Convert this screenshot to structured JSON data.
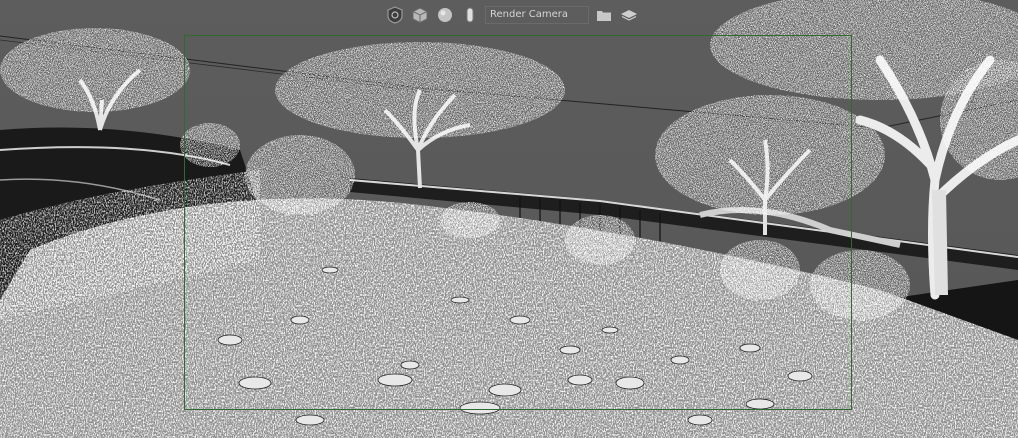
{
  "viewport": {
    "toolbar": {
      "camera_name": "Render Camera",
      "icons": [
        "camera-shield-icon",
        "cube-icon",
        "sphere-icon",
        "light-icon",
        "folder-icon",
        "layers-icon"
      ]
    }
  },
  "colors": {
    "background": "#5b5b5b",
    "film_gate": "#2f6a2f",
    "toolbar_icon": "#bdbdbd"
  }
}
